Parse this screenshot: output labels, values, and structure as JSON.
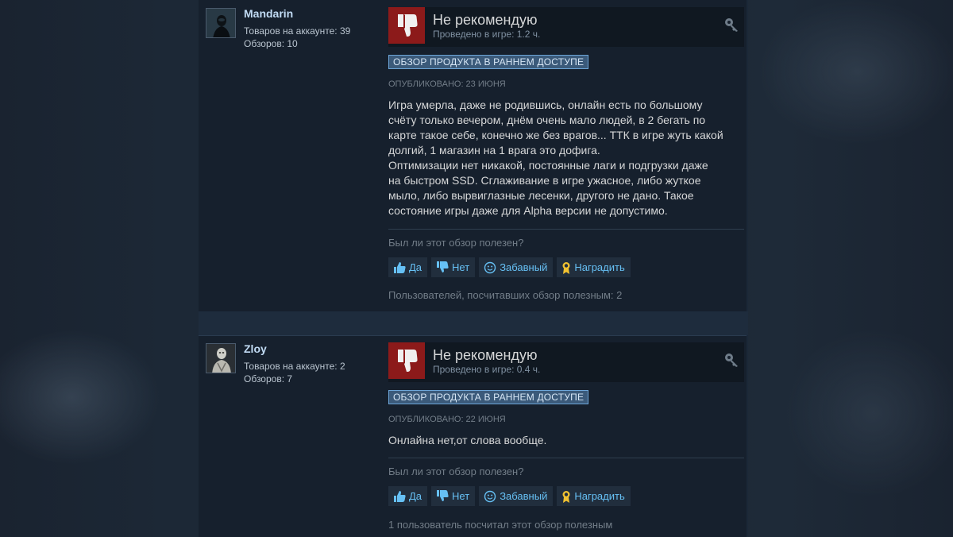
{
  "reviews": [
    {
      "author": "Mandarin",
      "products_label": "Товаров на аккаунте: 39",
      "reviews_label": "Обзоров: 10",
      "verdict": "Не рекомендую",
      "hours": "Проведено в игре: 1.2 ч.",
      "early_access": "ОБЗОР ПРОДУКТА В РАННЕМ ДОСТУПЕ",
      "posted": "ОПУБЛИКОВАНО: 23 ИЮНЯ",
      "text_lines": [
        "Игра умерла, даже не родившись, онлайн есть по большому",
        "счёту только вечером, днём очень мало людей, в 2 бегать по",
        "карте такое себе, конечно же без врагов... ТТК в игре жуть какой",
        "долгий, 1 магазин на 1 врага это дофига.",
        "Оптимизации нет никакой, постоянные лаги и подгрузки даже",
        "на быстром SSD. Сглаживание в игре ужасное, либо жуткое",
        "мыло, либо вырвиглазные лесенки, другого не дано. Такое",
        "состояние игры даже для Alpha версии не допустимо."
      ],
      "helpful_question": "Был ли этот обзор полезен?",
      "buttons": {
        "yes": "Да",
        "no": "Нет",
        "funny": "Забавный",
        "award": "Наградить"
      },
      "helpful_count": "Пользователей, посчитавших обзор полезным: 2"
    },
    {
      "author": "Zloy",
      "products_label": "Товаров на аккаунте: 2",
      "reviews_label": "Обзоров: 7",
      "verdict": "Не рекомендую",
      "hours": "Проведено в игре: 0.4 ч.",
      "early_access": "ОБЗОР ПРОДУКТА В РАННЕМ ДОСТУПЕ",
      "posted": "ОПУБЛИКОВАНО: 22 ИЮНЯ",
      "text_lines": [
        "Онлайна нет,от слова вообще."
      ],
      "helpful_question": "Был ли этот обзор полезен?",
      "buttons": {
        "yes": "Да",
        "no": "Нет",
        "funny": "Забавный",
        "award": "Наградить"
      },
      "helpful_count": "1 пользователь посчитал этот обзор полезным"
    }
  ],
  "colors": {
    "not_recommended": "#8c1a1a",
    "link": "#66c0f4",
    "author": "#c1dbf4"
  }
}
